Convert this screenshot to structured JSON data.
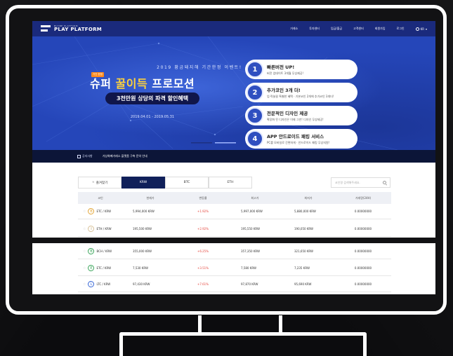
{
  "brand": {
    "logo_small": "BUYBE PLATFORM",
    "logo_main": "PLAY PLATFORM"
  },
  "nav": {
    "items": [
      "거래소",
      "투자센터",
      "입금/출금",
      "고객센터",
      "회원가입",
      "로그인"
    ],
    "lang": "KR"
  },
  "hero": {
    "headline": "2019 황금돼지해 기간한정 이벤트!",
    "tag": "기간 한정",
    "title_pre": "슈퍼 ",
    "title_highlight": "꿀이득",
    "title_post": " 프로모션",
    "pill": "3천만원 상당의 파격 할인혜택",
    "date": "2019.04.01 - 2019.05.31",
    "cards": [
      {
        "num": "1",
        "title": "빠른버전 UP!",
        "desc": "버전 업데이트 3개월 무상제공!"
      },
      {
        "num": "2",
        "title": "추가코인 3개 더!",
        "desc": "업·락놀릴 특별한 혜택 · 기본코인 2개에 추가코인 3개더!"
      },
      {
        "num": "3",
        "title": "전문적인 디자인 제공",
        "desc": "확장화 된 디자인은 이제 그만! 디자인 무상제공!"
      },
      {
        "num": "4",
        "title": "APP 안드로이드 패킹 서비스",
        "desc": "PC를 모바일로 간편하게 · 안드로이드 패킹 무상지원!"
      }
    ]
  },
  "notice": {
    "label": "공지사항",
    "text": "가상화폐거래소 플랫폼 구축 문의 안내"
  },
  "market": {
    "tabs": [
      "즐겨찾기",
      "KRW",
      "BTC",
      "ETH"
    ],
    "active_tab": "KRW",
    "search_placeholder": "코인명 검색해주세요.",
    "columns": [
      "코인",
      "현재가",
      "변동률",
      "최고가",
      "최저가",
      "거래량(24H)"
    ],
    "rows": [
      {
        "symbol": "B",
        "pair": "ETC / KRW",
        "price": "5,994,000 KRW",
        "change": "+1.92%",
        "high": "5,997,000 KRW",
        "low": "5,880,000 KRW",
        "volume": "0.00000000"
      },
      {
        "symbol": "I",
        "pair": "ETH / KRW",
        "price": "195,500 KRW",
        "change": "+2.92%",
        "high": "195,550 KRW",
        "low": "190,050 KRW",
        "volume": "0.00000000"
      },
      {
        "symbol": "B",
        "pair": "BCH / KRW",
        "price": "355,000 KRW",
        "change": "+6.25%",
        "high": "357,350 KRW",
        "low": "321,650 KRW",
        "volume": "0.00000000"
      },
      {
        "symbol": "E",
        "pair": "ETC / KRW",
        "price": "7,530 KRW",
        "change": "+3.51%",
        "high": "7,580 KRW",
        "low": "7,235 KRW",
        "volume": "0.00000000"
      },
      {
        "symbol": "L",
        "pair": "LTC / KRW",
        "price": "97,430 KRW",
        "change": "+7.61%",
        "high": "97,870 KRW",
        "low": "95,690 KRW",
        "volume": "0.00000000"
      }
    ]
  }
}
